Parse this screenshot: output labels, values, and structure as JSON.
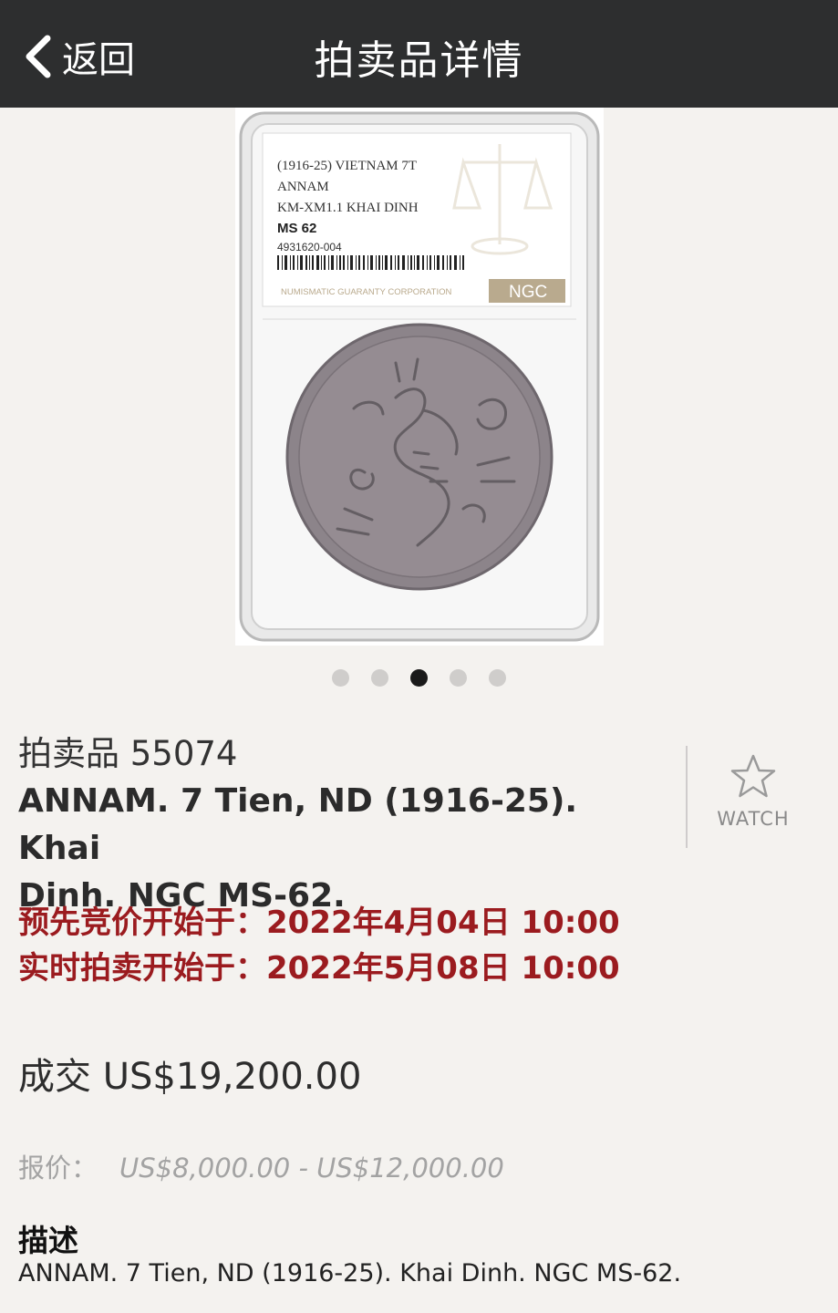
{
  "nav": {
    "back_label": "返回",
    "title": "拍卖品详情"
  },
  "slab": {
    "line1": "(1916-25) VIETNAM 7T",
    "line2": "ANNAM",
    "line3": "KM-XM1.1 KHAI DINH",
    "grade": "MS 62",
    "cert": "4931620-004",
    "footer": "NUMISMATIC GUARANTY CORPORATION",
    "brand": "NGC"
  },
  "carousel": {
    "count": 5,
    "active_index": 2
  },
  "lot": {
    "number_label": "拍卖品 55074",
    "title_line1": "ANNAM. 7 Tien, ND (1916-25). Khai",
    "title_line2": "Dinh. NGC MS-62."
  },
  "watch": {
    "label": "WATCH",
    "icon": "star-outline-icon"
  },
  "schedule": {
    "prebid": "预先竞价开始于：2022年4月04日 10:00",
    "live": "实时拍卖开始于：2022年5月08日 10:00"
  },
  "sold": {
    "text": "成交 US$19,200.00"
  },
  "estimate": {
    "label": "报价：",
    "range": "US$8,000.00 - US$12,000.00"
  },
  "description": {
    "heading": "描述",
    "text": "ANNAM. 7 Tien, ND (1916-25). Khai Dinh. NGC MS-62."
  },
  "colors": {
    "nav_bg": "#2d2e2f",
    "page_bg": "#f4f2ef",
    "schedule_red": "#9b1b1f"
  }
}
